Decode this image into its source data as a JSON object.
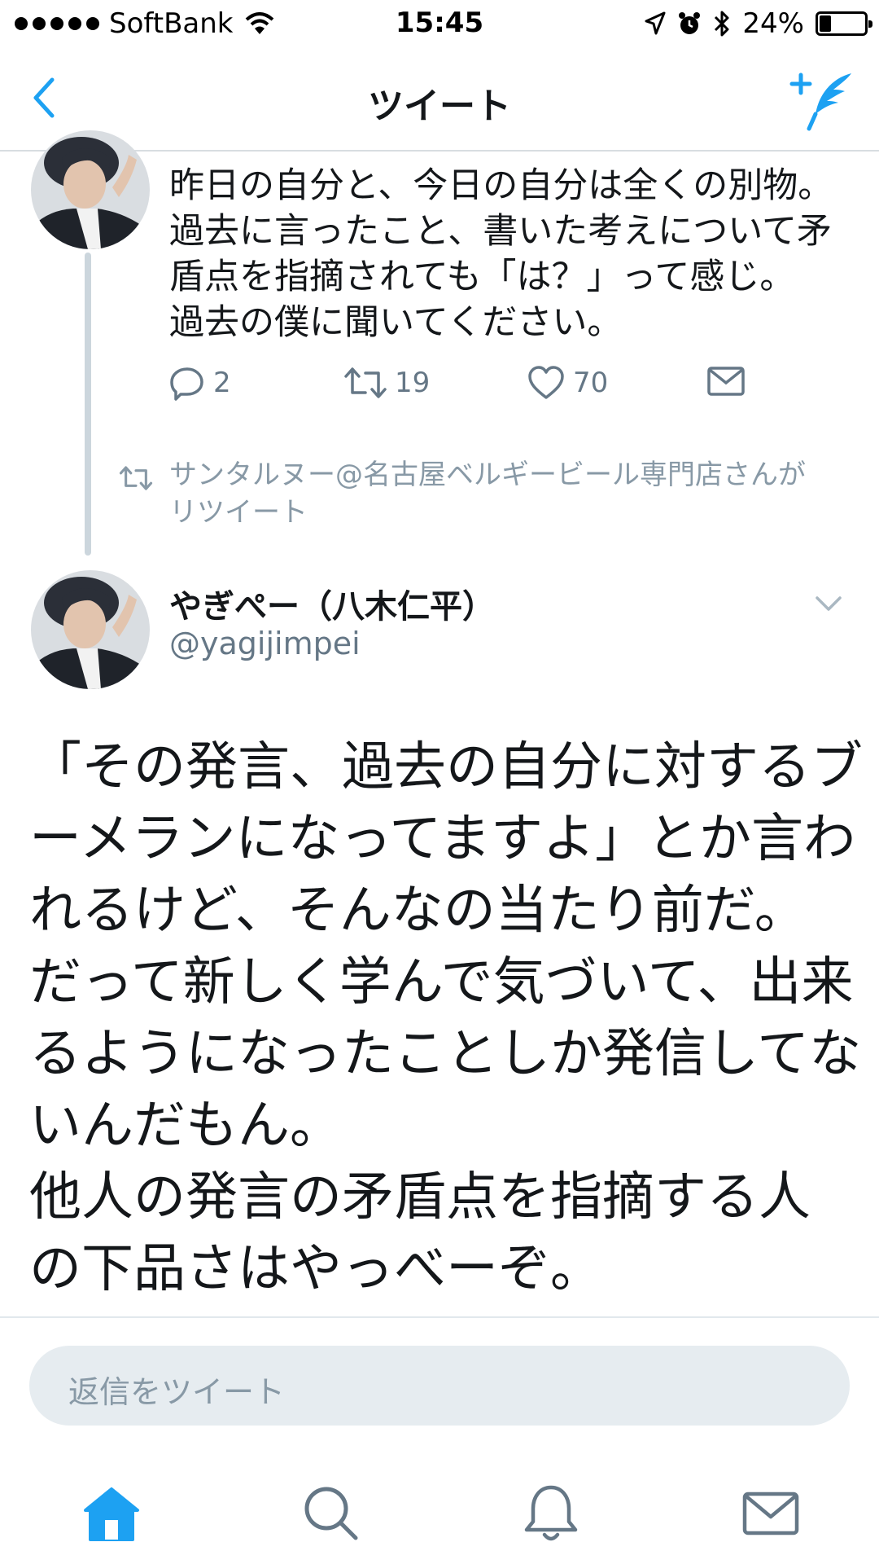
{
  "status_bar": {
    "carrier": "SoftBank",
    "time": "15:45",
    "battery_text": "24%",
    "battery_level": 0.24
  },
  "nav": {
    "title": "ツイート",
    "back_icon": "chevron-left-icon",
    "compose_icon": "compose-tweet-icon"
  },
  "previous_tweet": {
    "text_lines": [
      "昨日の自分と、今日の自分は全くの別物。",
      "過去に言ったこと、書いた考えについて矛",
      "盾点を指摘されても「は？」って感じ。",
      "過去の僕に聞いてください。"
    ],
    "reply_count": "2",
    "retweet_count": "19",
    "like_count": "70"
  },
  "retweet_context": {
    "text_lines": [
      "サンタルヌー@名古屋ベルギービール専門店さんが",
      "リツイート"
    ]
  },
  "main_tweet": {
    "display_name": "やぎぺー（八木仁平）",
    "handle": "@yagijimpei",
    "body_lines": [
      "「その発言、過去の自分に対するブ",
      "ーメランになってますよ」とか言わ",
      "れるけど、そんなの当たり前だ。",
      "だって新しく学んで気づいて、出来",
      "るようになったことしか発信してな",
      "いんだもん。",
      "他人の発言の矛盾点を指摘する人",
      "の下品さはやっべーぞ。"
    ]
  },
  "reply": {
    "placeholder": "返信をツイート"
  },
  "tab_bar": {
    "items": [
      "home-icon",
      "search-icon",
      "notifications-bell-icon",
      "messages-envelope-icon"
    ],
    "active": "home-icon"
  },
  "colors": {
    "accent": "#1da1f2",
    "text_primary": "#14171a",
    "text_secondary": "#657786",
    "text_muted": "#8899a6",
    "reply_bg": "#e6ecf0"
  }
}
